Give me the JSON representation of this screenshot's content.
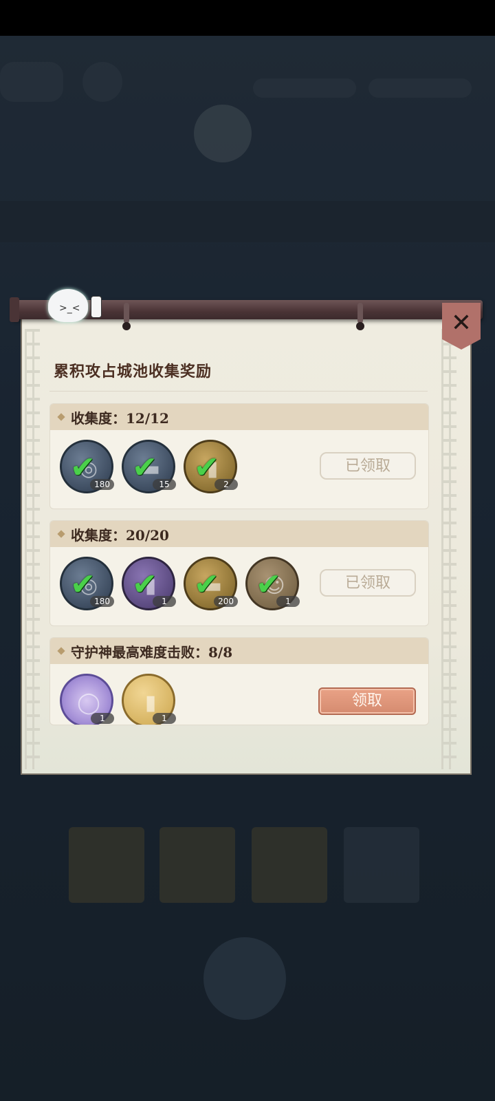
{
  "panel": {
    "title": "累积攻占城池收集奖励"
  },
  "tasks": [
    {
      "title": "收集度：12/12",
      "rewards": [
        {
          "icon": "coin-icon",
          "count": "180",
          "claimed": true
        },
        {
          "icon": "wood-plank-icon",
          "count": "15",
          "claimed": true
        },
        {
          "icon": "talisman-icon",
          "count": "2",
          "claimed": true
        }
      ],
      "button": "已领取"
    },
    {
      "title": "收集度：20/20",
      "rewards": [
        {
          "icon": "coin-icon",
          "count": "180",
          "claimed": true
        },
        {
          "icon": "scroll-icon",
          "count": "1",
          "claimed": true
        },
        {
          "icon": "ink-stone-icon",
          "count": "200",
          "claimed": true
        },
        {
          "icon": "character-portrait-icon",
          "count": "1",
          "claimed": true
        }
      ],
      "button": "已领取"
    },
    {
      "title": "守护神最高难度击败：8/8",
      "rewards": [
        {
          "icon": "frame-ring-icon",
          "count": "1",
          "claimed": false
        },
        {
          "icon": "gold-talisman-icon",
          "count": "1",
          "claimed": false
        }
      ],
      "button": "领取"
    }
  ],
  "colors": {
    "panel_bg": "#efece0",
    "header_bg": "#e3d6bf",
    "check_green": "#4ad04a",
    "claim_button": "#d58b70",
    "close_button": "#b1716a"
  }
}
